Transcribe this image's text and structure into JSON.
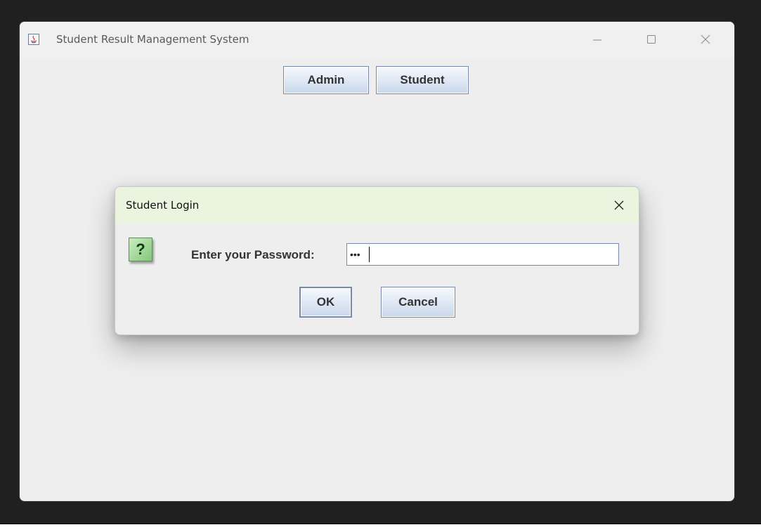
{
  "main_window": {
    "title": "Student Result Management System",
    "controls": {
      "minimize": "—",
      "maximize": "☐",
      "close": "✕"
    }
  },
  "mode_buttons": {
    "admin_label": "Admin",
    "student_label": "Student"
  },
  "dialog": {
    "title": "Student Login",
    "close_glyph": "✕",
    "icon_glyph": "?",
    "prompt": "Enter your Password:",
    "password_value": "•••",
    "ok_label": "OK",
    "cancel_label": "Cancel"
  },
  "colors": {
    "dialog_title_bg": "#eaf4de",
    "window_bg": "#eeeeee",
    "button_gradient_bottom": "#c9d8ec"
  },
  "icons": {
    "app": "java-icon",
    "dialog": "question-icon"
  }
}
